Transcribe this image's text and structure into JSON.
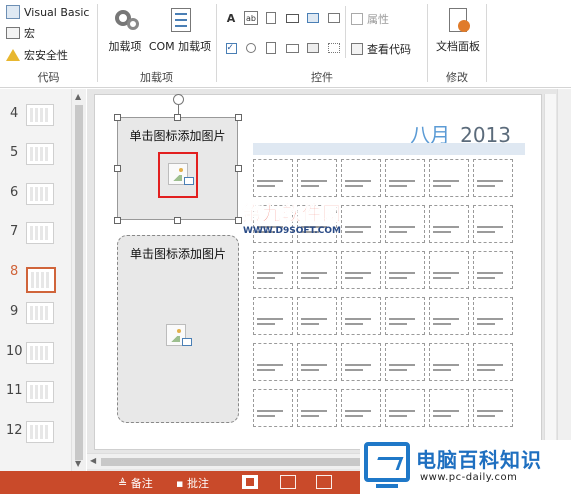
{
  "ribbon": {
    "code": {
      "visual_basic": "Visual Basic",
      "macros": "宏",
      "macro_security": "宏安全性",
      "label": "代码"
    },
    "addins": {
      "addins": "加载项",
      "com_addins": "COM 加载项",
      "label": "加载项"
    },
    "controls": {
      "properties": "属性",
      "view_code": "查看代码",
      "label": "控件"
    },
    "modify": {
      "document_panel": "文档面板",
      "label": "修改"
    }
  },
  "thumbnails": {
    "numbers": [
      "4",
      "5",
      "6",
      "7",
      "8",
      "9",
      "10",
      "11",
      "12"
    ],
    "selected": "8"
  },
  "slide": {
    "placeholder1_text": "单击图标添加图片",
    "placeholder2_text": "单击图标添加图片",
    "calendar": {
      "month": "八月",
      "year": "2013"
    }
  },
  "watermark": {
    "title": "第九软件网",
    "url": "WWW.D9SOFT.COM"
  },
  "status": {
    "notes": "备注",
    "comments": "批注"
  },
  "logo": {
    "name": "电脑百科知识",
    "url": "www.pc-daily.com"
  },
  "colors": {
    "status_bar": "#c94a2a",
    "selected_thumb": "#d0643a",
    "calendar_accent": "#5b9bd5",
    "selection_red": "#e21f1f"
  }
}
